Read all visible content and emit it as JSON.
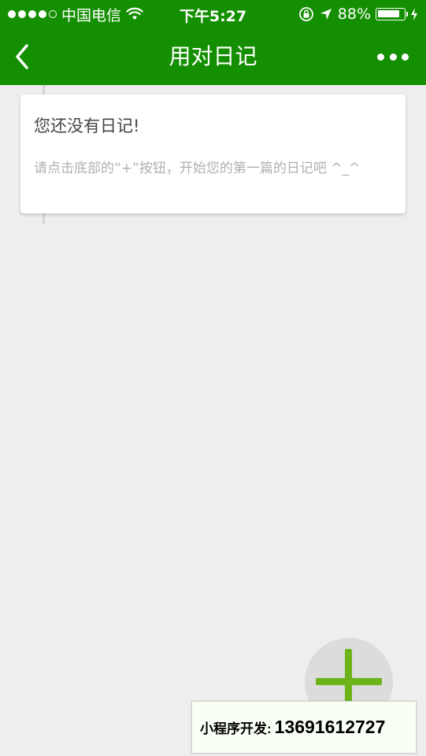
{
  "status_bar": {
    "carrier": "中国电信",
    "time": "下午5:27",
    "battery_text": "88%",
    "battery_level": 0.88,
    "signal_filled": 4,
    "signal_total": 5
  },
  "nav": {
    "title": "用对日记"
  },
  "card": {
    "title": "您还没有日记!",
    "hint": "请点击底部的“+”按钮，开始您的第一篇的日记吧 ^_^"
  },
  "promo": {
    "label": "小程序开发:",
    "phone": "13691612727"
  },
  "colors": {
    "brand_green": "#148f02",
    "fab_plus": "#6cb41a",
    "background": "#eeeeee"
  },
  "icons": {
    "back": "chevron-left-icon",
    "more": "more-dots-icon",
    "add": "plus-icon",
    "wifi": "wifi-icon",
    "rotation_lock": "rotation-lock-icon",
    "location": "location-arrow-icon",
    "battery": "battery-icon",
    "charging": "charging-bolt-icon"
  }
}
